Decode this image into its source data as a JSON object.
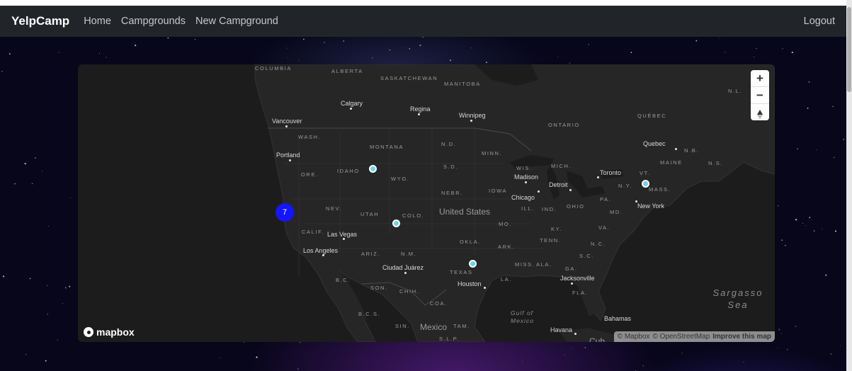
{
  "navbar": {
    "brand": "YelpCamp",
    "links": [
      "Home",
      "Campgrounds",
      "New Campground"
    ],
    "logout": "Logout",
    "background": "#212529"
  },
  "map": {
    "provider_logo": "mapbox",
    "attribution": {
      "copyright_mapbox": "© Mapbox",
      "copyright_osm": "© OpenStreetMap",
      "improve": "Improve this map"
    },
    "controls": {
      "zoom_in": "+",
      "zoom_out": "−",
      "compass_icon": "compass-arrow-icon"
    },
    "labels": {
      "regions": {
        "columbia": "COLUMBIA",
        "alberta": "ALBERTA",
        "saskatchewan": "SASKATCHEWAN",
        "manitoba": "MANITOBA",
        "ontario": "ONTARIO",
        "quebec_prov": "QUÉBEC",
        "nl": "N.L.",
        "nb": "N.B.",
        "ns": "N.S.",
        "wash": "WASH.",
        "montana": "MONTANA",
        "nd": "N.D.",
        "minn": "MINN.",
        "ore": "ORE.",
        "idaho": "IDAHO",
        "wyo": "WYO.",
        "sd": "S.D.",
        "wis": "WIS.",
        "mich": "MICH.",
        "vt": "VT.",
        "maine": "MAINE",
        "ny": "N.Y.",
        "mass": "MASS.",
        "nev": "NEV.",
        "utah": "UTAH",
        "colo": "COLO.",
        "nebr": "NEBR.",
        "iowa": "IOWA",
        "ill": "ILL.",
        "ind": "IND.",
        "ohio": "OHIO",
        "pa": "PA.",
        "md": "MD.",
        "calif": "CALIF.",
        "mo": "MO.",
        "ky": "KY.",
        "va": "VA.",
        "ariz": "ARIZ.",
        "nm": "N.M.",
        "okla": "OKLA.",
        "ark": "ARK.",
        "tenn": "TENN.",
        "nc": "N.C.",
        "sc": "S.C.",
        "miss": "MISS.",
        "ala": "ALA.",
        "ga": "GA.",
        "texas": "TEXAS",
        "la": "LA.",
        "fla": "FLA.",
        "bc": "B.C.",
        "son": "SON.",
        "chih": "CHIH.",
        "coa": "COA.",
        "bcs": "B.C.S.",
        "sin": "SIN.",
        "tam": "TAM.",
        "slp": "S.L.P."
      },
      "countries": {
        "us": "United States",
        "mexico": "Mexico",
        "cuba": "Cub"
      },
      "cities": {
        "calgary": "Calgary",
        "regina": "Regina",
        "winnipeg": "Winnipeg",
        "vancouver": "Vancouver",
        "quebec": "Quebec",
        "portland": "Portland",
        "madison": "Madison",
        "toronto": "Toronto",
        "detroit": "Detroit",
        "chicago": "Chicago",
        "new_york": "New York",
        "las_vegas": "Las Vegas",
        "los_angeles": "Los Angeles",
        "ciudad_juarez": "Ciudad Juárez",
        "houston": "Houston",
        "jacksonville": "Jacksonville",
        "havana": "Havana",
        "bahamas": "Bahamas"
      },
      "water": {
        "gulf": "Gulf of",
        "gulf2": "Mexico",
        "sargasso": "Sargasso",
        "sargasso2": "Sea"
      }
    },
    "cluster_count": "7",
    "markers": [
      {
        "name": "campground-marker-idaho",
        "lat": 44.5,
        "lng": -112.5
      },
      {
        "name": "campground-marker-colorado",
        "lat": 38.3,
        "lng": -106.5
      },
      {
        "name": "campground-marker-texas",
        "lat": 31.8,
        "lng": -95.8
      },
      {
        "name": "campground-marker-massachusetts",
        "lat": 42.2,
        "lng": -72.1
      }
    ],
    "colors": {
      "marker": "#6ad6ea",
      "cluster": "#1414ff",
      "land": "#262626",
      "water": "#1c1c1c"
    }
  }
}
